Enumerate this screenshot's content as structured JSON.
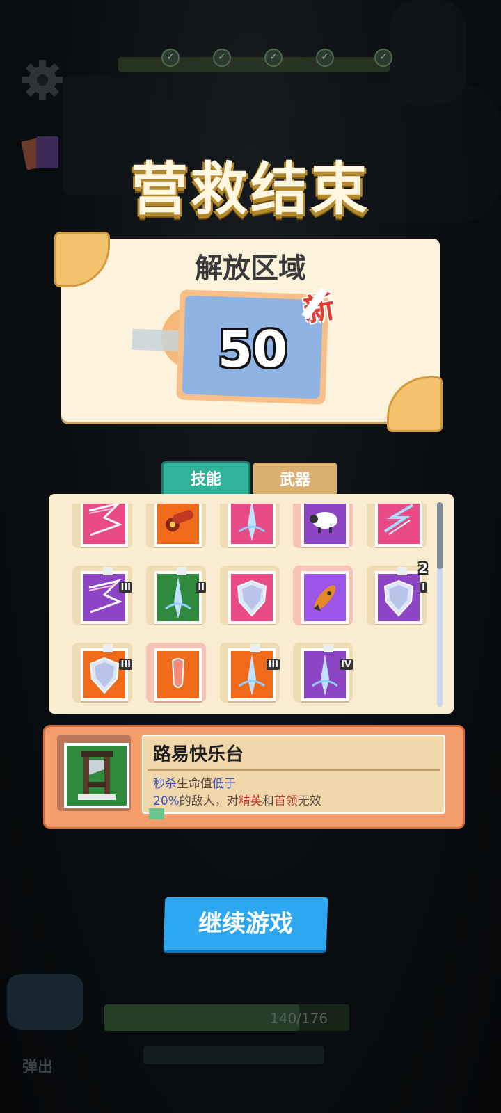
{
  "hud": {
    "settings_icon": "gear-icon",
    "cards_icon": "cards-icon",
    "hp_text": "140/176",
    "eject_label": "弹出"
  },
  "result": {
    "title": "营救结束",
    "panel_title": "解放区域",
    "zone_value": "50",
    "new_badge": "新"
  },
  "tabs": [
    {
      "label": "技能",
      "active": true
    },
    {
      "label": "武器",
      "active": false
    }
  ],
  "skills": [
    {
      "icon": "lightning-icon",
      "color": "#e94b86",
      "slot": "normal"
    },
    {
      "icon": "cannon-icon",
      "color": "#ef6a1a",
      "slot": "normal"
    },
    {
      "icon": "ice-spike-icon",
      "color": "#e94b86",
      "slot": "normal"
    },
    {
      "icon": "sheep-icon",
      "color": "#8d45c6",
      "slot": "pink"
    },
    {
      "icon": "chain-lightning-icon",
      "color": "#e94b86",
      "slot": "normal"
    },
    {
      "icon": "lightning-icon",
      "color": "#8d45c6",
      "slot": "normal",
      "roman": "III"
    },
    {
      "icon": "ice-spike-icon",
      "color": "#2f8a3e",
      "slot": "normal",
      "roman": "II"
    },
    {
      "icon": "shield-icon",
      "color": "#e94b86",
      "slot": "normal"
    },
    {
      "icon": "rocket-icon",
      "color": "#9b55e8",
      "slot": "pink"
    },
    {
      "icon": "shield-icon",
      "color": "#8d45c6",
      "slot": "normal",
      "roman": "I",
      "count": "2"
    },
    {
      "icon": "shield-icon",
      "color": "#ef6a1a",
      "slot": "normal",
      "roman": "III"
    },
    {
      "icon": "tooth-icon",
      "color": "#ef6a1a",
      "slot": "pink"
    },
    {
      "icon": "ice-spike-icon",
      "color": "#ef6a1a",
      "slot": "normal",
      "roman": "III"
    },
    {
      "icon": "ice-spike-icon",
      "color": "#8d45c6",
      "slot": "normal",
      "roman": "IV"
    }
  ],
  "detail": {
    "icon": "guillotine-icon",
    "name": "路易快乐台",
    "desc1_a": "秒杀",
    "desc1_b": "生命值",
    "desc1_c": "低于",
    "desc2_a": "20%",
    "desc2_b": "的敌人，对",
    "desc2_c": "精英",
    "desc2_d": "和",
    "desc2_e": "首领",
    "desc2_f": "无效"
  },
  "buttons": {
    "continue_label": "继续游戏"
  },
  "colors": {
    "accent_teal": "#2fb39a",
    "button_blue": "#2ea7f1",
    "title_gold": "#b58a2c"
  }
}
